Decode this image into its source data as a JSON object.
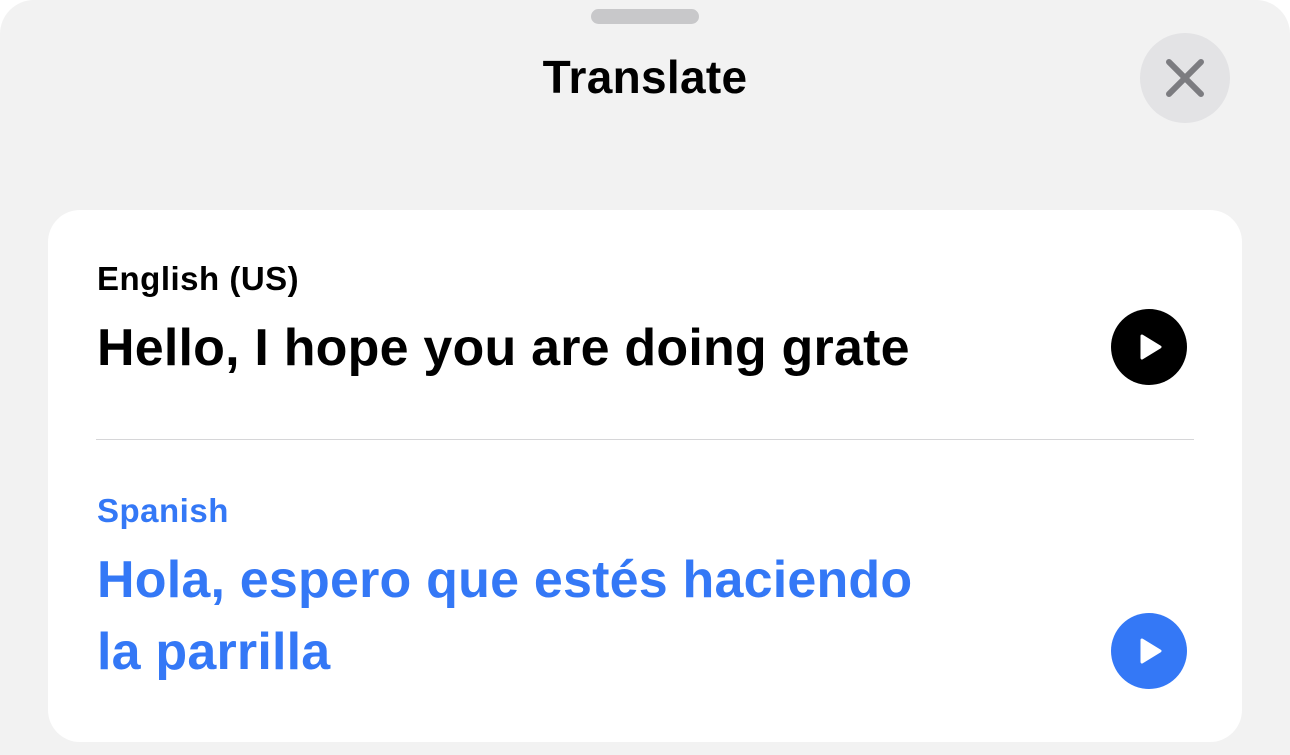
{
  "header": {
    "title": "Translate",
    "close_icon": "close-icon"
  },
  "source": {
    "language": "English (US)",
    "text": "Hello, I hope you are doing grate",
    "play_icon": "play-icon",
    "color": "#000000"
  },
  "target": {
    "language": "Spanish",
    "text_line1": "Hola, espero que estés haciendo",
    "text_line2": "la parrilla",
    "play_icon": "play-icon",
    "color": "#3478f6"
  },
  "colors": {
    "accent": "#3478f6",
    "sheet_background": "#f2f2f2",
    "card_background": "#ffffff"
  }
}
